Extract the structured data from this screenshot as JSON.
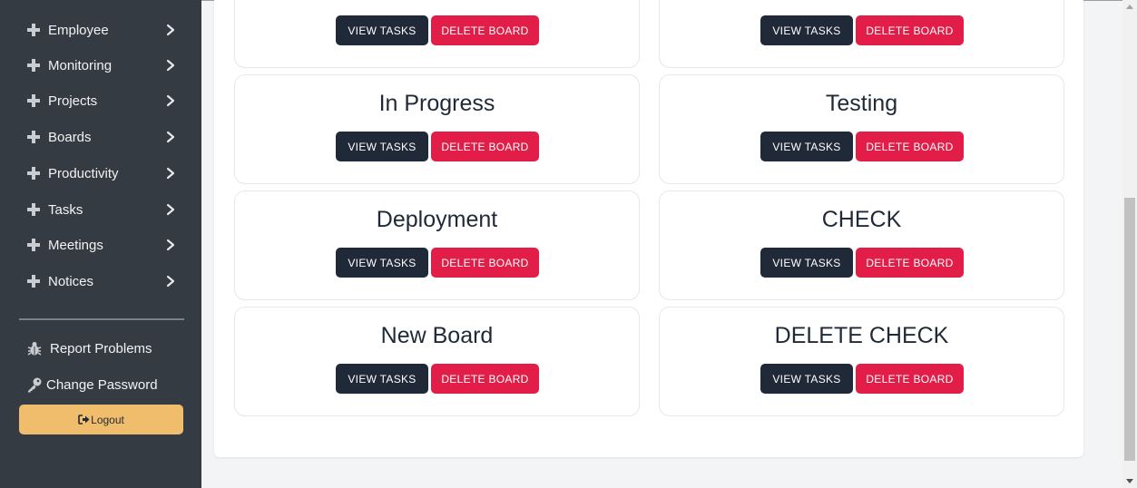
{
  "sidebar": {
    "nav_items": [
      {
        "label": "Employee"
      },
      {
        "label": "Monitoring"
      },
      {
        "label": "Projects"
      },
      {
        "label": "Boards"
      },
      {
        "label": "Productivity"
      },
      {
        "label": "Tasks"
      },
      {
        "label": "Meetings"
      },
      {
        "label": "Notices"
      }
    ],
    "report_problems": "Report Problems",
    "change_password": "Change Password",
    "logout": "Logout"
  },
  "boards": [
    {
      "title": "",
      "view_label": "VIEW TASKS",
      "delete_label": "DELETE BOARD"
    },
    {
      "title": "",
      "view_label": "VIEW TASKS",
      "delete_label": "DELETE BOARD"
    },
    {
      "title": "In Progress",
      "view_label": "VIEW TASKS",
      "delete_label": "DELETE BOARD"
    },
    {
      "title": "Testing",
      "view_label": "VIEW TASKS",
      "delete_label": "DELETE BOARD"
    },
    {
      "title": "Deployment",
      "view_label": "VIEW TASKS",
      "delete_label": "DELETE BOARD"
    },
    {
      "title": "CHECK",
      "view_label": "VIEW TASKS",
      "delete_label": "DELETE BOARD"
    },
    {
      "title": "New Board",
      "view_label": "VIEW TASKS",
      "delete_label": "DELETE BOARD"
    },
    {
      "title": "DELETE CHECK",
      "view_label": "VIEW TASKS",
      "delete_label": "DELETE BOARD"
    }
  ],
  "colors": {
    "sidebar_bg": "#353b43",
    "view_button": "#1f2937",
    "delete_button": "#e11d48",
    "logout_button": "#f0bd6c"
  }
}
